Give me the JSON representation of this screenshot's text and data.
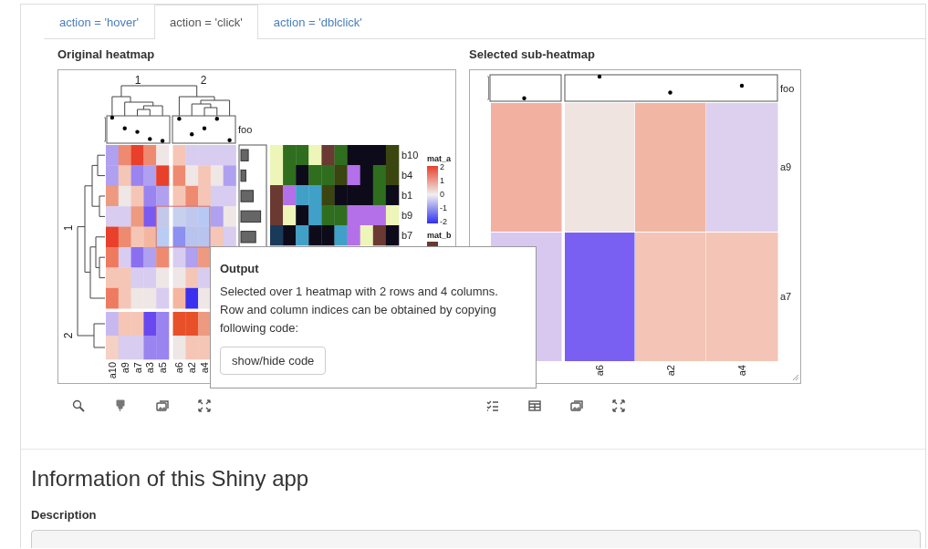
{
  "tabs": [
    {
      "label": "action = 'hover'",
      "selected": false
    },
    {
      "label": "action = 'click'",
      "selected": true
    },
    {
      "label": "action = 'dblclick'",
      "selected": false
    }
  ],
  "original_heatmap": {
    "title": "Original heatmap",
    "column_splits": [
      "1",
      "2"
    ],
    "row_splits": [
      "1",
      "2"
    ],
    "annotation": {
      "label": "foo"
    },
    "rows": [
      {
        "cells": [
          {
            "color": "#b0a0f0"
          },
          {
            "color": "#ee8a70"
          },
          {
            "color": "#e8402a"
          },
          {
            "color": "#ee8a70"
          },
          {
            "color": "#efe6e6"
          },
          {
            "color": "#f5c6b6"
          },
          {
            "color": "#d8ccf0"
          },
          {
            "color": "#d8ccf0"
          },
          {
            "color": "#d8ccf0"
          },
          {
            "color": "#d8ccf0"
          }
        ]
      },
      {
        "cells": [
          {
            "color": "#b0a0f0"
          },
          {
            "color": "#f5c6b6"
          },
          {
            "color": "#9a84f0"
          },
          {
            "color": "#b0a0f0"
          },
          {
            "color": "#e8402a"
          },
          {
            "color": "#ee8a70"
          },
          {
            "color": "#efe6e6"
          },
          {
            "color": "#f5c6b6"
          },
          {
            "color": "#efe6e6"
          },
          {
            "color": "#b0a0f0"
          }
        ]
      },
      {
        "cells": [
          {
            "color": "#ee9a80"
          },
          {
            "color": "#efe6e6"
          },
          {
            "color": "#f5c6b6"
          },
          {
            "color": "#9a84f0"
          },
          {
            "color": "#b0a0f0"
          },
          {
            "color": "#f5c6b6"
          },
          {
            "color": "#ee8a70"
          },
          {
            "color": "#f5c6b6"
          },
          {
            "color": "#d8ccf0"
          },
          {
            "color": "#d8ccf0"
          }
        ]
      },
      {
        "cells": [
          {
            "color": "#d8ccf0"
          },
          {
            "color": "#d8ccf0"
          },
          {
            "color": "#ee9a80"
          },
          {
            "color": "#7a5af0"
          },
          {
            "color": "#c4c8ea"
          },
          {
            "color": "#c8d0f0"
          },
          {
            "color": "#c0c8ee"
          },
          {
            "color": "#b8c8f4"
          },
          {
            "color": "#b0a0f0"
          },
          {
            "color": "#efe6e6"
          }
        ]
      },
      {
        "cells": [
          {
            "color": "#e8402a"
          },
          {
            "color": "#ee8a70"
          },
          {
            "color": "#f5c6b6"
          },
          {
            "color": "#f5b6a0"
          },
          {
            "color": "#b8ccf4"
          },
          {
            "color": "#8c90f0"
          },
          {
            "color": "#b8c4ee"
          },
          {
            "color": "#b8c4ee"
          },
          {
            "color": "#f5c6b6"
          },
          {
            "color": "#d8ccf0"
          }
        ]
      },
      {
        "cells": [
          {
            "color": "#ee7a60"
          },
          {
            "color": "#d8ccf0"
          },
          {
            "color": "#8a70f0"
          },
          {
            "color": "#b0a0f0"
          },
          {
            "color": "#ee8a70"
          },
          {
            "color": "#d8ccf0"
          },
          {
            "color": "#b0a0f0"
          },
          {
            "color": "#ee9a80"
          }
        ]
      },
      {
        "cells": [
          {
            "color": "#f5c6b6"
          },
          {
            "color": "#f5c6b6"
          },
          {
            "color": "#d8ccf0"
          },
          {
            "color": "#d8ccf0"
          },
          {
            "color": "#efe6e6"
          },
          {
            "color": "#efe6e6"
          },
          {
            "color": "#f5c6b6"
          },
          {
            "color": "#d8ccf0"
          }
        ]
      },
      {
        "cells": [
          {
            "color": "#ee7a60"
          },
          {
            "color": "#f5c6b6"
          },
          {
            "color": "#efe6e6"
          },
          {
            "color": "#efe6e6"
          },
          {
            "color": "#d8ccf0"
          },
          {
            "color": "#f5b6a0"
          },
          {
            "color": "#3a30f0"
          },
          {
            "color": "#efe6e6"
          }
        ]
      },
      {
        "cells": [
          {
            "color": "#c8b8f0"
          },
          {
            "color": "#f5c6b6"
          },
          {
            "color": "#f5c6b6"
          },
          {
            "color": "#6a48f0"
          },
          {
            "color": "#9a84f0"
          },
          {
            "color": "#e8502a"
          },
          {
            "color": "#e8502a"
          },
          {
            "color": "#ee9a80"
          }
        ]
      },
      {
        "cells": [
          {
            "color": "#f5d0c4"
          },
          {
            "color": "#d8ccf0"
          },
          {
            "color": "#d8ccf0"
          },
          {
            "color": "#9a84f0"
          },
          {
            "color": "#9a84f0"
          },
          {
            "color": "#efe6e6"
          },
          {
            "color": "#f5c6b6"
          },
          {
            "color": "#f5c6b6"
          }
        ]
      }
    ],
    "column_labels": [
      "a10",
      "a9",
      "a7",
      "a3",
      "a5",
      "a6",
      "a2",
      "a4"
    ],
    "matrix_b": {
      "row_labels": [
        "b10",
        "b4",
        "b1",
        "b9",
        "b7"
      ],
      "rows": [
        {
          "cells": [
            {
              "color": "#eef5b8"
            },
            {
              "color": "#2e6e1e"
            },
            {
              "color": "#2e6e1e"
            },
            {
              "color": "#eef5b8"
            },
            {
              "color": "#6a3a32"
            },
            {
              "color": "#2e6e1e"
            },
            {
              "color": "#0d0b1a"
            },
            {
              "color": "#0d0b1a"
            },
            {
              "color": "#0d0b1a"
            },
            {
              "color": "#3b4510"
            }
          ]
        },
        {
          "cells": [
            {
              "color": "#eef5b8"
            },
            {
              "color": "#2e6e1e"
            },
            {
              "color": "#0d0b1a"
            },
            {
              "color": "#2e6e1e"
            },
            {
              "color": "#2e6e1e"
            },
            {
              "color": "#3b4510"
            },
            {
              "color": "#b470e8"
            },
            {
              "color": "#0d0b1a"
            },
            {
              "color": "#2e6e1e"
            },
            {
              "color": "#3b4510"
            }
          ]
        },
        {
          "cells": [
            {
              "color": "#6a3a32"
            },
            {
              "color": "#b470e8"
            },
            {
              "color": "#40a0c8"
            },
            {
              "color": "#40a0c8"
            },
            {
              "color": "#3b4510"
            },
            {
              "color": "#0d0b1a"
            },
            {
              "color": "#0d0b1a"
            },
            {
              "color": "#0d0b1a"
            },
            {
              "color": "#2e6e1e"
            },
            {
              "color": "#0d0b1a"
            }
          ]
        },
        {
          "cells": [
            {
              "color": "#6a3a32"
            },
            {
              "color": "#eef5b8"
            },
            {
              "color": "#0d0b1a"
            },
            {
              "color": "#40a0c8"
            },
            {
              "color": "#2e6e1e"
            },
            {
              "color": "#2e6e1e"
            },
            {
              "color": "#b470e8"
            },
            {
              "color": "#b470e8"
            },
            {
              "color": "#b470e8"
            },
            {
              "color": "#eef5b8"
            }
          ]
        },
        {
          "cells": [
            {
              "color": "#1a3a5a"
            },
            {
              "color": "#0d0b1a"
            },
            {
              "color": "#40a0c8"
            },
            {
              "color": "#0d0b1a"
            },
            {
              "color": "#0d0b1a"
            },
            {
              "color": "#40a0c8"
            },
            {
              "color": "#b470e8"
            },
            {
              "color": "#eef5b8"
            },
            {
              "color": "#6a3a32"
            },
            {
              "color": "#0d0b1a"
            }
          ]
        }
      ]
    },
    "legends": [
      {
        "title": "mat_a",
        "kind": "gradient",
        "labels": [
          "2",
          "1",
          "0",
          "-1",
          "-2"
        ]
      },
      {
        "title": "mat_b",
        "kind": "discrete",
        "swatches": [
          {
            "color": "#6a3a32"
          }
        ]
      }
    ],
    "toolbar": [
      {
        "kind": "search"
      },
      {
        "kind": "highlighter"
      },
      {
        "kind": "image"
      },
      {
        "kind": "expand"
      }
    ]
  },
  "sub_heatmap": {
    "title": "Selected sub-heatmap",
    "annotation": {
      "label": "foo"
    },
    "rows": [
      {
        "cells": [
          {
            "color": "#f2b0a0"
          },
          {
            "color": "#f0e4e0"
          },
          {
            "color": "#f2b6a4"
          },
          {
            "color": "#ddd0ee"
          }
        ]
      },
      {
        "cells": [
          {
            "color": "#d8c8f0"
          },
          {
            "color": "#7a60f2"
          },
          {
            "color": "#f4c4b6"
          },
          {
            "color": "#f4c4b6"
          }
        ]
      }
    ],
    "row_labels": [
      "a9",
      "a7"
    ],
    "column_labels": [
      "a6",
      "a2",
      "a4"
    ],
    "toolbar": [
      {
        "kind": "checklist"
      },
      {
        "kind": "table"
      },
      {
        "kind": "image"
      },
      {
        "kind": "expand"
      }
    ]
  },
  "popup": {
    "title": "Output",
    "text": "Selected over 1 heatmap with 2 rows and 4 columns. Row and column indices can be obtained by copying following code:",
    "button": "show/hide code"
  },
  "info": {
    "heading": "Information of this Shiny app",
    "description_label": "Description"
  }
}
